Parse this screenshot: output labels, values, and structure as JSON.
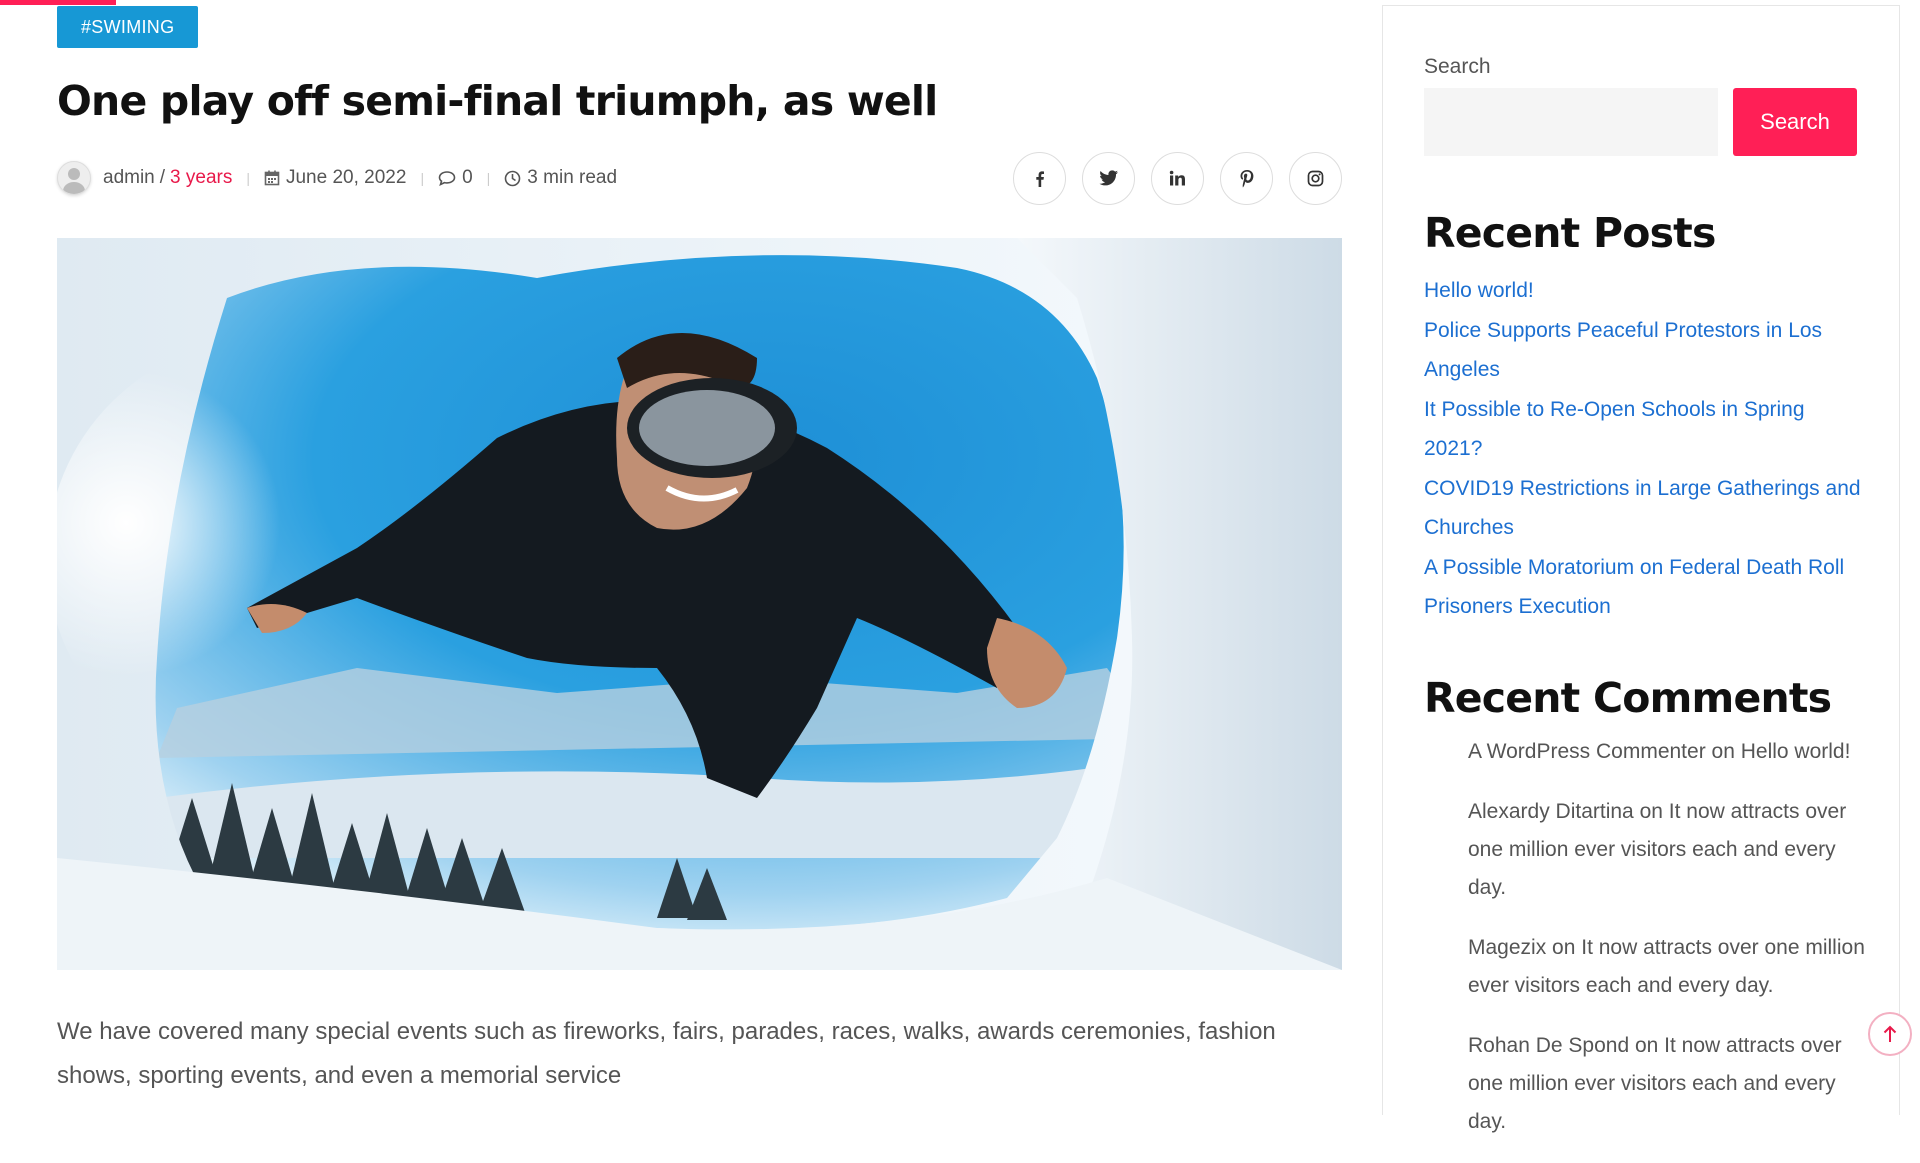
{
  "article": {
    "tag": "#SWIMING",
    "title": "One play off semi-final triumph, as well",
    "meta": {
      "author": "admin",
      "author_separator": "/",
      "age": "3 years",
      "date": "June 20, 2022",
      "comments": "0",
      "read_time": "3 min read"
    },
    "share_icons": [
      "facebook-icon",
      "twitter-icon",
      "linkedin-icon",
      "pinterest-icon",
      "instagram-icon"
    ],
    "excerpt": "We have covered many special events such as fireworks, fairs, parades, races, walks, awards ceremonies, fashion shows, sporting events, and even a memorial service"
  },
  "sidebar": {
    "search": {
      "label": "Search",
      "placeholder": "",
      "button": "Search"
    },
    "recent_posts": {
      "title": "Recent Posts",
      "items": [
        "Hello world!",
        "Police Supports Peaceful Protestors in Los Angeles",
        "It Possible to Re-Open Schools in Spring 2021?",
        "COVID19 Restrictions in Large Gatherings and Churches",
        "A Possible Moratorium on Federal Death Roll Prisoners Execution"
      ]
    },
    "recent_comments": {
      "title": "Recent Comments",
      "items": [
        {
          "author": "A WordPress Commenter",
          "on": "on",
          "post": "Hello world!"
        },
        {
          "author": "Alexardy Ditartina",
          "on": "on",
          "post": "It now attracts over one million ever visitors each and every day."
        },
        {
          "author": "Magezix",
          "on": "on",
          "post": "It now attracts over one million ever visitors each and every day."
        },
        {
          "author": "Rohan De Spond",
          "on": "on",
          "post": "It now attracts over one million ever visitors each and every day."
        }
      ]
    }
  },
  "colors": {
    "accent": "#ff1f56",
    "tag_bg": "#1798d5",
    "link": "#1c6fd1"
  }
}
